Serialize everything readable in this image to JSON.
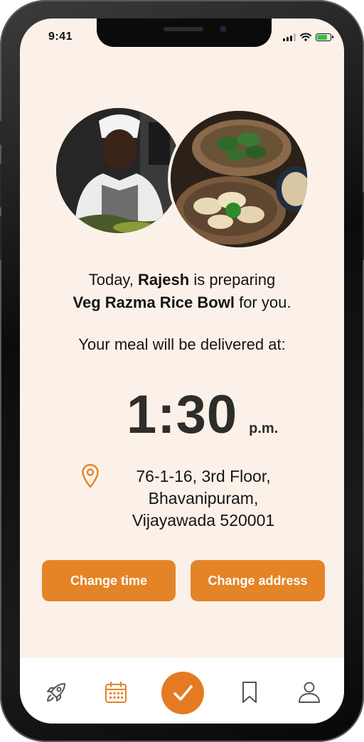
{
  "status_bar": {
    "time": "9:41"
  },
  "order": {
    "intro": "Today,",
    "chef_name": "Rajesh",
    "preparing_text": "is preparing",
    "meal_name": "Veg Razma Rice Bowl",
    "for_you_text": "for you.",
    "delivery_label": "Your meal will be delivered at:",
    "delivery_time": "1:30",
    "delivery_period": "p.m."
  },
  "address": {
    "line1": "76-1-16, 3rd Floor,",
    "line2": "Bhavanipuram,",
    "line3": "Vijayawada 520001"
  },
  "actions": {
    "change_time": "Change time",
    "change_address": "Change address"
  },
  "tabs": [
    {
      "icon": "rocket-icon"
    },
    {
      "icon": "calendar-icon"
    },
    {
      "icon": "checkmark-icon"
    },
    {
      "icon": "bookmark-icon"
    },
    {
      "icon": "user-icon"
    }
  ],
  "colors": {
    "accent": "#e48427",
    "background": "#fbf1e8",
    "text": "#151515"
  }
}
